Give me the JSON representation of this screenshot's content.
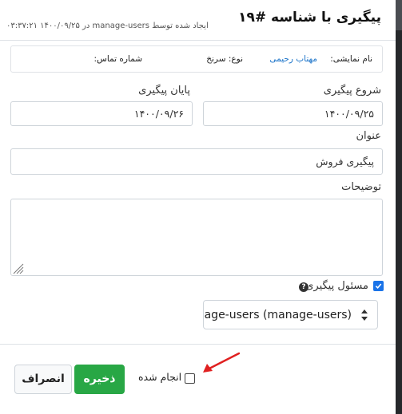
{
  "modal": {
    "title": "پیگیری با شناسه #۱۹",
    "subtitle": "ایجاد شده توسط manage-users در ۱۴۰۰/۰۹/۲۵ ۰۳:۳۷:۲۱"
  },
  "info": {
    "display_name_label": "نام نمایشی:",
    "display_name_value": "مهتاب رحیمی",
    "type_label": "نوع: سرنخ",
    "phone_label": "شماره تماس:"
  },
  "form": {
    "start_label": "شروع پیگیری",
    "start_value": "۱۴۰۰/۰۹/۲۵",
    "end_label": "پایان پیگیری",
    "end_value": "۱۴۰۰/۰۹/۲۶",
    "subject_label": "عنوان",
    "subject_value": "پیگیری فروش",
    "description_label": "توضیحات",
    "description_value": "",
    "responsible_label": "مسئول پیگیری",
    "responsible_checked": true,
    "responsible_select_value": "nage-users (manage-users)"
  },
  "footer": {
    "done_label": "انجام شده",
    "done_checked": false,
    "save_label": "ذخیره",
    "cancel_label": "انصراف"
  },
  "colors": {
    "accent_blue": "#1a73e8",
    "save_green": "#28a745",
    "annotation_red": "#e02020",
    "link_blue": "#1a73c9"
  },
  "icons": {
    "help": "question-circle-icon",
    "select_arrows": "chevron-up-down-icon",
    "annotation": "red-arrow-icon"
  }
}
